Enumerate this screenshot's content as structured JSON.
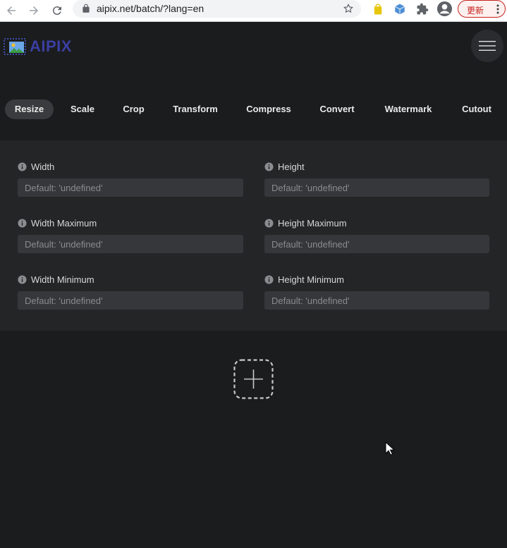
{
  "browser": {
    "url": "aipix.net/batch/?lang=en",
    "update_label": "更新"
  },
  "app": {
    "logo_text": "AIPIX",
    "brand_color": "#3b3fa3"
  },
  "tabs": [
    {
      "label": "Resize",
      "active": true
    },
    {
      "label": "Scale",
      "active": false
    },
    {
      "label": "Crop",
      "active": false
    },
    {
      "label": "Transform",
      "active": false
    },
    {
      "label": "Compress",
      "active": false
    },
    {
      "label": "Convert",
      "active": false
    },
    {
      "label": "Watermark",
      "active": false
    },
    {
      "label": "Cutout",
      "active": false
    }
  ],
  "fields": [
    {
      "label": "Width",
      "placeholder": "Default: 'undefined'"
    },
    {
      "label": "Height",
      "placeholder": "Default: 'undefined'"
    },
    {
      "label": "Width Maximum",
      "placeholder": "Default: 'undefined'"
    },
    {
      "label": "Height Maximum",
      "placeholder": "Default: 'undefined'"
    },
    {
      "label": "Width Minimum",
      "placeholder": "Default: 'undefined'"
    },
    {
      "label": "Height Minimum",
      "placeholder": "Default: 'undefined'"
    }
  ]
}
